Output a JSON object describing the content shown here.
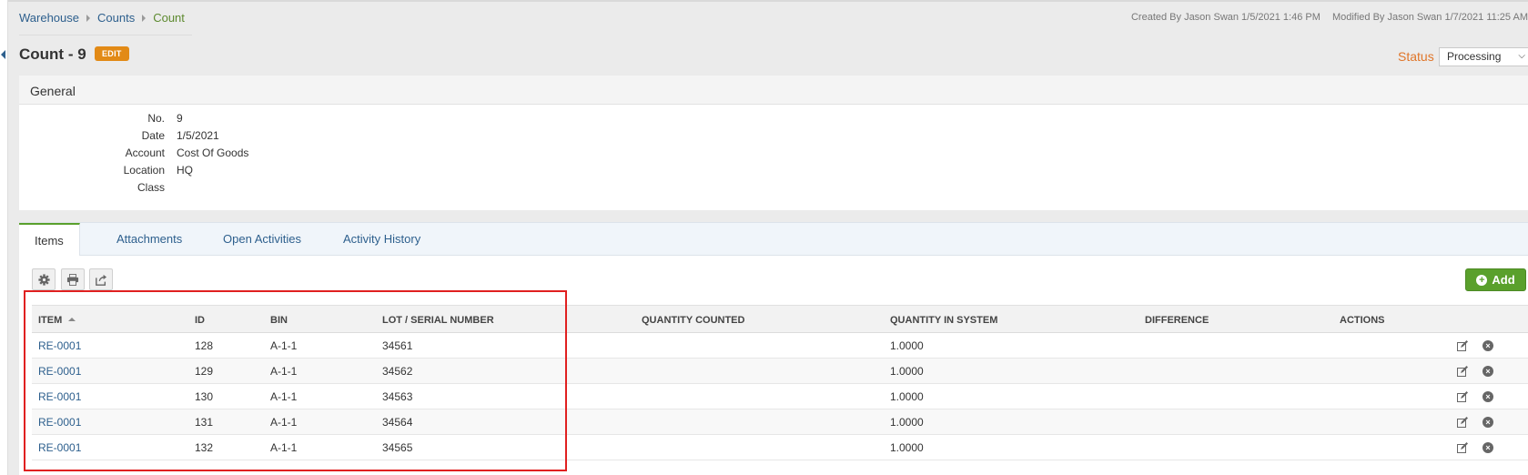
{
  "breadcrumb": [
    "Warehouse",
    "Counts",
    "Count"
  ],
  "meta": {
    "created": "Created By Jason Swan 1/5/2021 1:46 PM",
    "modified": "Modified By Jason Swan 1/7/2021 11:25 AM"
  },
  "page": {
    "title": "Count - 9",
    "edit_label": "EDIT"
  },
  "status": {
    "label": "Status",
    "value": "Processing"
  },
  "general": {
    "heading": "General",
    "fields": [
      {
        "label": "No.",
        "value": "9"
      },
      {
        "label": "Date",
        "value": "1/5/2021"
      },
      {
        "label": "Account",
        "value": "Cost Of Goods"
      },
      {
        "label": "Location",
        "value": "HQ"
      },
      {
        "label": "Class",
        "value": ""
      }
    ]
  },
  "tabs": [
    "Items",
    "Attachments",
    "Open Activities",
    "Activity History"
  ],
  "toolbar": {
    "add_label": "Add"
  },
  "table": {
    "columns": [
      "ITEM",
      "ID",
      "BIN",
      "LOT / SERIAL NUMBER",
      "QUANTITY COUNTED",
      "QUANTITY IN SYSTEM",
      "DIFFERENCE",
      "ACTIONS"
    ],
    "rows": [
      {
        "item": "RE-0001",
        "id": "128",
        "bin": "A-1-1",
        "lot": "34561",
        "counted": "",
        "system": "1.0000",
        "difference": ""
      },
      {
        "item": "RE-0001",
        "id": "129",
        "bin": "A-1-1",
        "lot": "34562",
        "counted": "",
        "system": "1.0000",
        "difference": ""
      },
      {
        "item": "RE-0001",
        "id": "130",
        "bin": "A-1-1",
        "lot": "34563",
        "counted": "",
        "system": "1.0000",
        "difference": ""
      },
      {
        "item": "RE-0001",
        "id": "131",
        "bin": "A-1-1",
        "lot": "34564",
        "counted": "",
        "system": "1.0000",
        "difference": ""
      },
      {
        "item": "RE-0001",
        "id": "132",
        "bin": "A-1-1",
        "lot": "34565",
        "counted": "",
        "system": "1.0000",
        "difference": ""
      }
    ]
  },
  "colors": {
    "link": "#2d5f8d",
    "accent_orange": "#e28a16",
    "add_green": "#5aa02c",
    "highlight": "#e02020"
  }
}
